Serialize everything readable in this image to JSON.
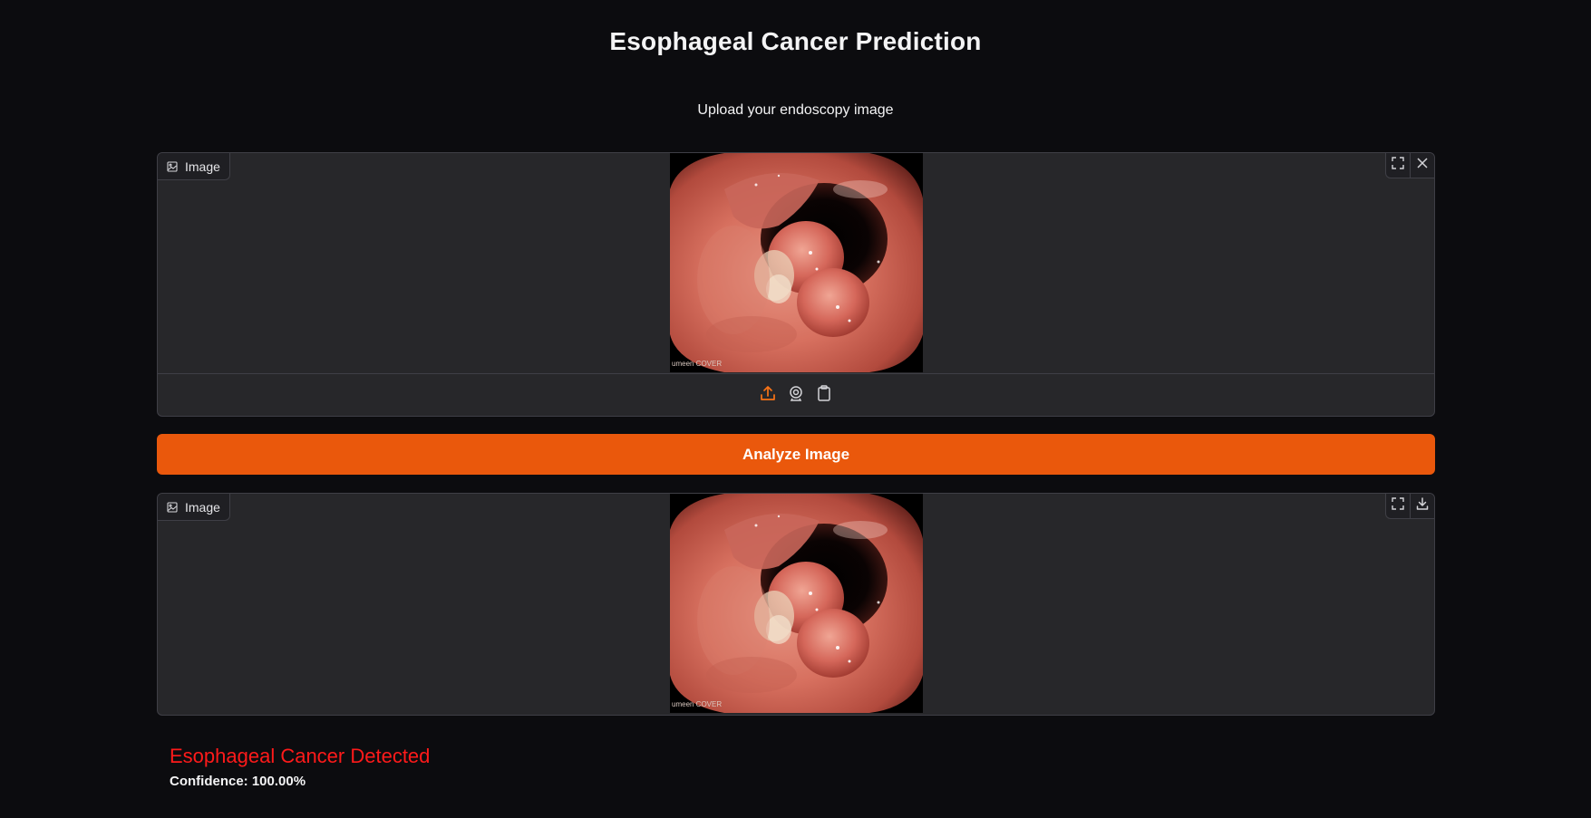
{
  "page": {
    "title": "Esophageal Cancer Prediction",
    "subtitle": "Upload your endoscopy image"
  },
  "input_panel": {
    "label": "Image",
    "icons": [
      "image-icon",
      "fullscreen-icon",
      "close-icon"
    ],
    "sources": [
      "upload-icon",
      "webcam-icon",
      "clipboard-icon"
    ],
    "image_watermark": "umeen COVER"
  },
  "analyze_button": {
    "label": "Analyze Image",
    "color": "#ea580c"
  },
  "output_panel": {
    "label": "Image",
    "icons": [
      "image-icon",
      "fullscreen-icon",
      "download-icon"
    ],
    "image_watermark": "umeen COVER"
  },
  "result": {
    "text": "Esophageal Cancer Detected",
    "color": "#ff1a1a",
    "confidence_label": "Confidence:",
    "confidence_value": "100.00%"
  },
  "colors": {
    "background": "#0c0c0f",
    "panel": "#27272a",
    "accent": "#ea580c"
  }
}
